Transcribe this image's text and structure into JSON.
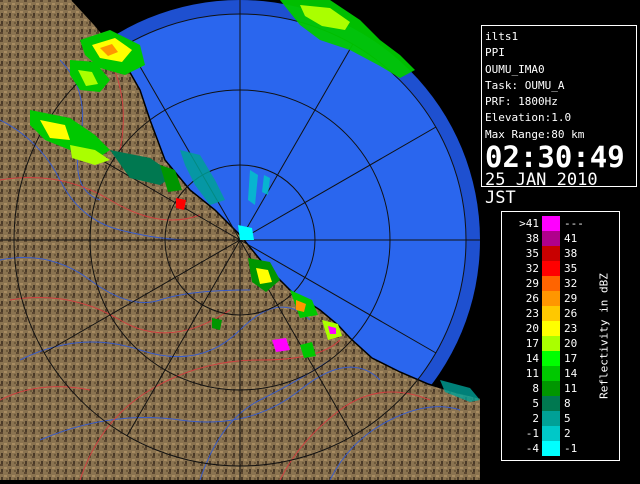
{
  "info_panel": {
    "radar_name": "ilts1",
    "product": "PPI",
    "site": "OUMU_IMA0",
    "task": "Task: OUMU_A",
    "prf": "PRF: 1800Hz",
    "elevation": "Elevation:1.0",
    "max_range": "Max Range:80 km",
    "time": "02:30:49",
    "date": "25 JAN 2010 JST"
  },
  "legend": {
    "title": "Reflectivity in dBZ",
    "rows": [
      {
        "low": ">41",
        "high": "---",
        "color": "#ff00ff"
      },
      {
        "low": "38",
        "high": "41",
        "color": "#b0008c"
      },
      {
        "low": "35",
        "high": "38",
        "color": "#c80000"
      },
      {
        "low": "32",
        "high": "35",
        "color": "#ff0000"
      },
      {
        "low": "29",
        "high": "32",
        "color": "#ff6400"
      },
      {
        "low": "26",
        "high": "29",
        "color": "#ff9600"
      },
      {
        "low": "23",
        "high": "26",
        "color": "#ffc800"
      },
      {
        "low": "20",
        "high": "23",
        "color": "#ffff00"
      },
      {
        "low": "17",
        "high": "20",
        "color": "#aaff00"
      },
      {
        "low": "14",
        "high": "17",
        "color": "#00ff00"
      },
      {
        "low": "11",
        "high": "14",
        "color": "#00c800"
      },
      {
        "low": "8",
        "high": "11",
        "color": "#009600"
      },
      {
        "low": "5",
        "high": "8",
        "color": "#007850"
      },
      {
        "low": "2",
        "high": "5",
        "color": "#00a096"
      },
      {
        "low": "-1",
        "high": "2",
        "color": "#00c8c8"
      },
      {
        "low": "-4",
        "high": "-1",
        "color": "#00ffff"
      }
    ]
  },
  "colors": {
    "sea": "#2a66ee",
    "outer_ring": "#1e50d0",
    "land": "#8a7350",
    "land_dark": "#5a4630",
    "rivers": "#3a5cc8",
    "boundaries": "#d04040",
    "grid": "#222222"
  }
}
